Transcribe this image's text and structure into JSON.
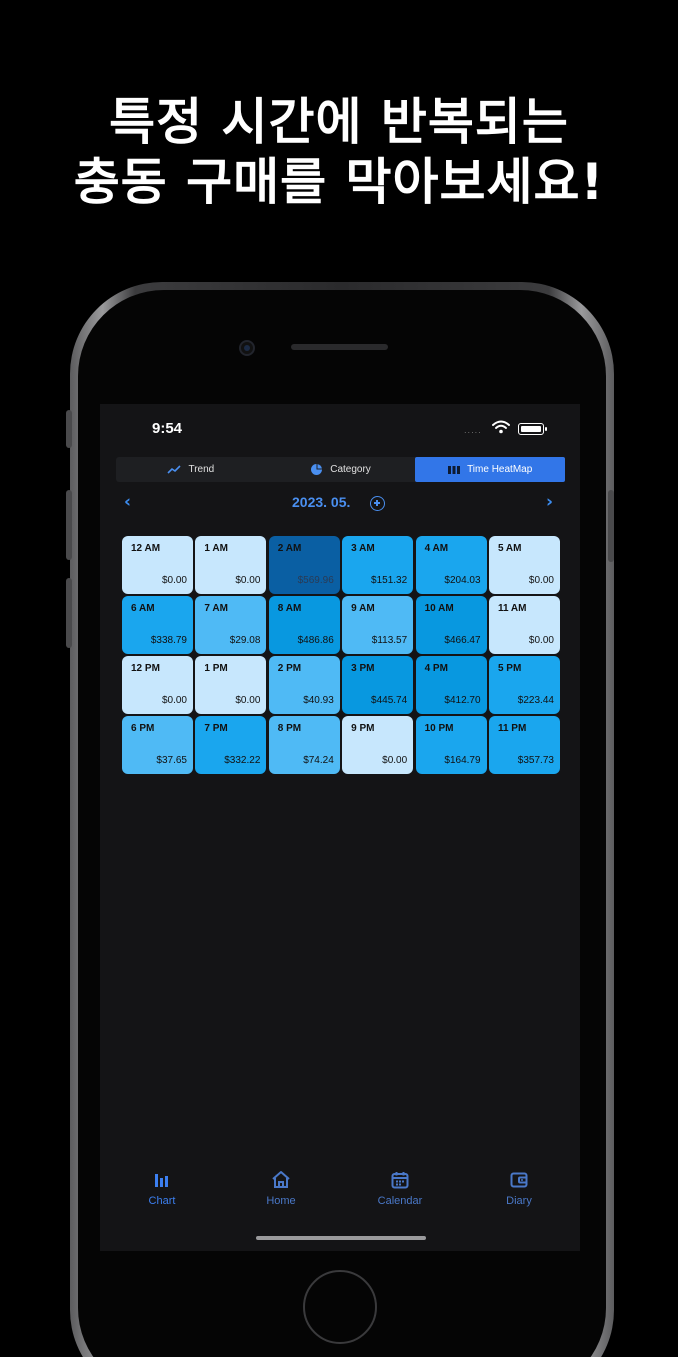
{
  "headline": {
    "line1": "특정 시간에 반복되는",
    "line2": "충동 구매를 막아보세요!"
  },
  "status_bar": {
    "time": "9:54",
    "signal": "....."
  },
  "segments": [
    {
      "label": "Trend",
      "icon": "trend-line-icon",
      "active": false
    },
    {
      "label": "Category",
      "icon": "pie-chart-icon",
      "active": false
    },
    {
      "label": "Time HeatMap",
      "icon": "heatmap-grid-icon",
      "active": true
    }
  ],
  "month_nav": {
    "prev": "‹",
    "label": "2023. 05.",
    "next": "›"
  },
  "colors": {
    "accent": "#3276e8",
    "level_0": "#c7e7fd",
    "level_1": "#86cef7",
    "level_2": "#4fbaf5",
    "level_3": "#1aa6ee",
    "level_4": "#0898e0",
    "level_5": "#0a5fa3"
  },
  "heatmap": [
    {
      "hour": "12 AM",
      "amount": "$0.00",
      "level": 0
    },
    {
      "hour": "1 AM",
      "amount": "$0.00",
      "level": 0
    },
    {
      "hour": "2 AM",
      "amount": "$569.96",
      "level": 5
    },
    {
      "hour": "3 AM",
      "amount": "$151.32",
      "level": 3
    },
    {
      "hour": "4 AM",
      "amount": "$204.03",
      "level": 3
    },
    {
      "hour": "5 AM",
      "amount": "$0.00",
      "level": 0
    },
    {
      "hour": "6 AM",
      "amount": "$338.79",
      "level": 3
    },
    {
      "hour": "7 AM",
      "amount": "$29.08",
      "level": 2
    },
    {
      "hour": "8 AM",
      "amount": "$486.86",
      "level": 4
    },
    {
      "hour": "9 AM",
      "amount": "$113.57",
      "level": 2
    },
    {
      "hour": "10 AM",
      "amount": "$466.47",
      "level": 4
    },
    {
      "hour": "11 AM",
      "amount": "$0.00",
      "level": 0
    },
    {
      "hour": "12 PM",
      "amount": "$0.00",
      "level": 0
    },
    {
      "hour": "1 PM",
      "amount": "$0.00",
      "level": 0
    },
    {
      "hour": "2 PM",
      "amount": "$40.93",
      "level": 2
    },
    {
      "hour": "3 PM",
      "amount": "$445.74",
      "level": 4
    },
    {
      "hour": "4 PM",
      "amount": "$412.70",
      "level": 4
    },
    {
      "hour": "5 PM",
      "amount": "$223.44",
      "level": 3
    },
    {
      "hour": "6 PM",
      "amount": "$37.65",
      "level": 2
    },
    {
      "hour": "7 PM",
      "amount": "$332.22",
      "level": 3
    },
    {
      "hour": "8 PM",
      "amount": "$74.24",
      "level": 2
    },
    {
      "hour": "9 PM",
      "amount": "$0.00",
      "level": 0
    },
    {
      "hour": "10 PM",
      "amount": "$164.79",
      "level": 3
    },
    {
      "hour": "11 PM",
      "amount": "$357.73",
      "level": 3
    }
  ],
  "tabbar": [
    {
      "label": "Chart",
      "icon": "bar-chart-icon",
      "active": true
    },
    {
      "label": "Home",
      "icon": "home-icon",
      "active": false
    },
    {
      "label": "Calendar",
      "icon": "calendar-icon",
      "active": false
    },
    {
      "label": "Diary",
      "icon": "wallet-icon",
      "active": false
    }
  ]
}
